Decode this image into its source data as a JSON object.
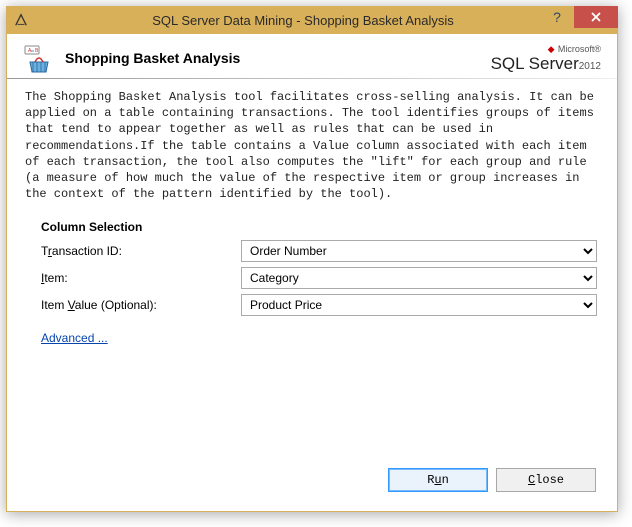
{
  "titlebar": {
    "title": "SQL Server Data Mining - Shopping Basket Analysis"
  },
  "header": {
    "heading": "Shopping Basket Analysis",
    "logo": {
      "vendor": "Microsoft®",
      "product": "SQL Server",
      "year": "2012"
    }
  },
  "description": "The Shopping Basket Analysis tool facilitates cross-selling analysis. It can be applied on a table containing transactions. The tool identifies groups of items that tend to appear together as well as rules that can be used in recommendations.If the table contains a Value column associated with each item of each transaction, the tool also computes the \"lift\" for each group and rule (a measure of how much the value of the respective item or group increases in the context of the pattern identified by the tool).",
  "columnSelection": {
    "sectionLabel": "Column Selection",
    "fields": {
      "transactionId": {
        "label_pre": "T",
        "label_ul": "r",
        "label_post": "ansaction ID:",
        "value": "Order Number"
      },
      "item": {
        "label_pre": "",
        "label_ul": "I",
        "label_post": "tem:",
        "value": "Category"
      },
      "itemValue": {
        "label_pre": "Item ",
        "label_ul": "V",
        "label_post": "alue (Optional):",
        "value": "Product Price"
      }
    },
    "advanced": "Advanced ..."
  },
  "buttons": {
    "run_pre": "R",
    "run_ul": "u",
    "run_post": "n",
    "close_pre": "",
    "close_ul": "C",
    "close_post": "lose"
  }
}
